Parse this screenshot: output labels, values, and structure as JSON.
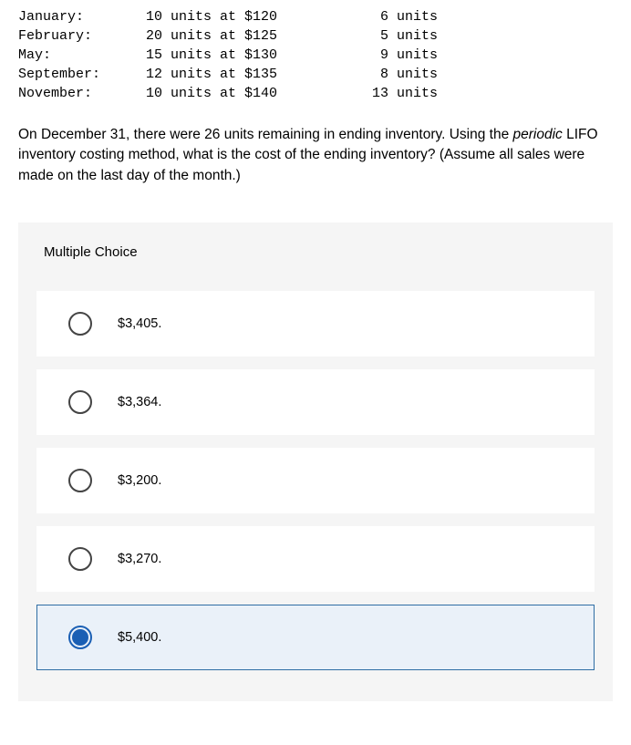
{
  "purchases": [
    {
      "month": "January:",
      "desc": "10 units at $120",
      "sold": "6 units"
    },
    {
      "month": "February:",
      "desc": "20 units at $125",
      "sold": "5 units"
    },
    {
      "month": "May:",
      "desc": "15 units at $130",
      "sold": "9 units"
    },
    {
      "month": "September:",
      "desc": "12 units at $135",
      "sold": "8 units"
    },
    {
      "month": "November:",
      "desc": "10 units at $140",
      "sold": "13 units"
    }
  ],
  "question": {
    "part1": "On December 31, there were 26 units remaining in ending inventory. Using the ",
    "italic": "periodic",
    "part2": " LIFO inventory costing method, what is the cost of the ending inventory? (Assume all sales were made on the last day of the month.)"
  },
  "mc_header": "Multiple Choice",
  "options": [
    {
      "label": "$3,405.",
      "selected": false
    },
    {
      "label": "$3,364.",
      "selected": false
    },
    {
      "label": "$3,200.",
      "selected": false
    },
    {
      "label": "$3,270.",
      "selected": false
    },
    {
      "label": "$5,400.",
      "selected": true
    }
  ]
}
